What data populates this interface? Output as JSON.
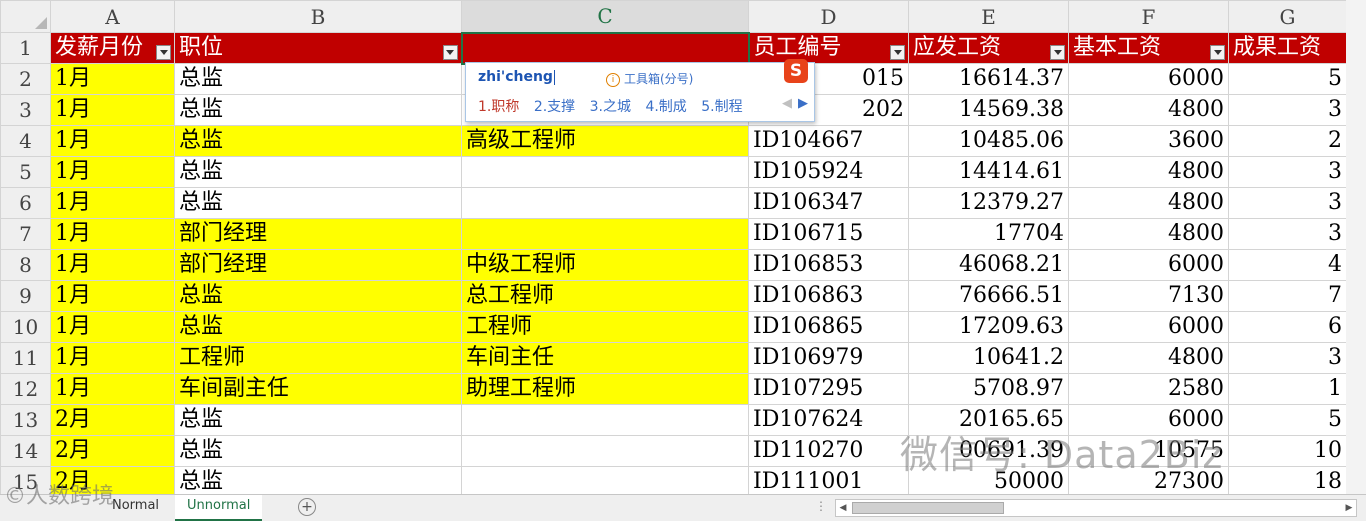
{
  "columns": [
    "A",
    "B",
    "C",
    "D",
    "E",
    "F",
    "G"
  ],
  "selected_column": "C",
  "header_row": {
    "num": "1",
    "cells": [
      "发薪月份",
      "职位",
      "",
      "员工编号",
      "应发工资",
      "基本工资",
      "成果工资"
    ]
  },
  "rows": [
    {
      "num": "2",
      "month": "1月",
      "position": "总监",
      "title": "",
      "id": "",
      "gross": "16614.37",
      "base": "6000",
      "result": "5"
    },
    {
      "num": "3",
      "month": "1月",
      "position": "总监",
      "title": "",
      "id": "",
      "gross": "14569.38",
      "base": "4800",
      "result": "3"
    },
    {
      "num": "4",
      "month": "1月",
      "position": "总监",
      "title": "高级工程师",
      "id": "ID104667",
      "gross": "10485.06",
      "base": "3600",
      "result": "2"
    },
    {
      "num": "5",
      "month": "1月",
      "position": "总监",
      "title": "",
      "id": "ID105924",
      "gross": "14414.61",
      "base": "4800",
      "result": "3"
    },
    {
      "num": "6",
      "month": "1月",
      "position": "总监",
      "title": "",
      "id": "ID106347",
      "gross": "12379.27",
      "base": "4800",
      "result": "3"
    },
    {
      "num": "7",
      "month": "1月",
      "position": "部门经理",
      "title": "",
      "id": "ID106715",
      "gross": "17704",
      "base": "4800",
      "result": "3"
    },
    {
      "num": "8",
      "month": "1月",
      "position": "部门经理",
      "title": "中级工程师",
      "id": "ID106853",
      "gross": "46068.21",
      "base": "6000",
      "result": "4"
    },
    {
      "num": "9",
      "month": "1月",
      "position": "总监",
      "title": "总工程师",
      "id": "ID106863",
      "gross": "76666.51",
      "base": "7130",
      "result": "7"
    },
    {
      "num": "10",
      "month": "1月",
      "position": "总监",
      "title": "工程师",
      "id": "ID106865",
      "gross": "17209.63",
      "base": "6000",
      "result": "6"
    },
    {
      "num": "11",
      "month": "1月",
      "position": "工程师",
      "title": "车间主任",
      "id": "ID106979",
      "gross": "10641.2",
      "base": "4800",
      "result": "3"
    },
    {
      "num": "12",
      "month": "1月",
      "position": "车间副主任",
      "title": "助理工程师",
      "id": "ID107295",
      "gross": "5708.97",
      "base": "2580",
      "result": "1"
    },
    {
      "num": "13",
      "month": "2月",
      "position": "总监",
      "title": "",
      "id": "ID107624",
      "gross": "20165.65",
      "base": "6000",
      "result": "5"
    },
    {
      "num": "14",
      "month": "2月",
      "position": "总监",
      "title": "",
      "id": "ID110270",
      "gross": "00691.39",
      "base": "10575",
      "result": "10"
    },
    {
      "num": "15",
      "month": "2月",
      "position": "总监",
      "title": "",
      "id": "ID111001",
      "gross": "50000",
      "base": "27300",
      "result": "18"
    }
  ],
  "partial_ids": {
    "r2": "015",
    "r3": "202"
  },
  "ime": {
    "composition": "zhi'cheng",
    "toolbox": "工具箱(分号)",
    "toolbox_icon": "info-icon",
    "logo": "S",
    "candidates": [
      "1.职称",
      "2.支撑",
      "3.之城",
      "4.制成",
      "5.制程"
    ]
  },
  "tabs": [
    "Normal",
    "Unnormal"
  ],
  "active_tab": "Unnormal",
  "watermarks": {
    "wechat": "微信号: Data2Biz",
    "bottom_left": "©人数跨境"
  },
  "colors": {
    "header_bg": "#c00000",
    "highlight": "#ffff00",
    "accent": "#217346"
  }
}
